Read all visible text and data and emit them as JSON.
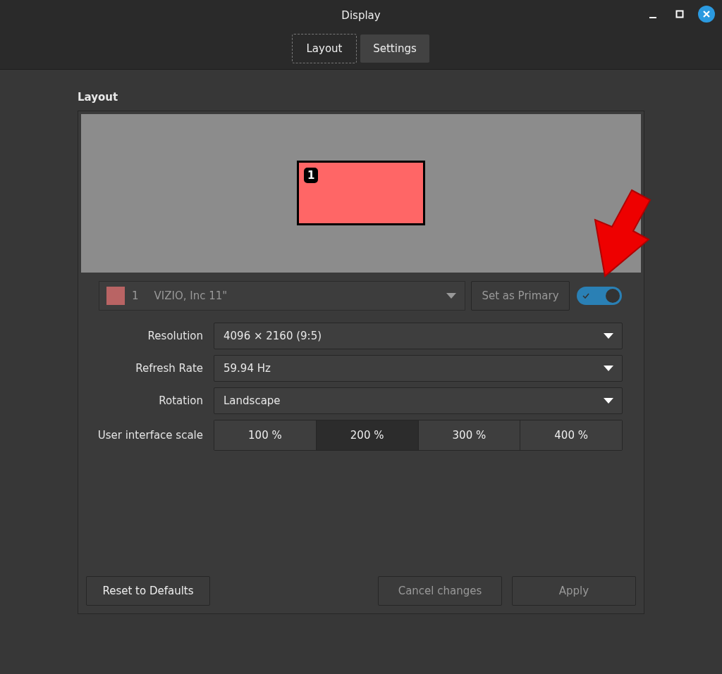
{
  "window": {
    "title": "Display"
  },
  "tabs": [
    {
      "label": "Layout",
      "selected": true
    },
    {
      "label": "Settings",
      "selected": false
    }
  ],
  "section_title": "Layout",
  "monitors": [
    {
      "number": "1",
      "color": "#ff6666"
    }
  ],
  "monitor_select": {
    "number": "1",
    "name": "VIZIO, Inc 11\"",
    "disabled": true
  },
  "set_primary_button": {
    "label": "Set as Primary",
    "disabled": true
  },
  "enabled_switch": {
    "on": true
  },
  "settings": [
    {
      "label": "Resolution",
      "value": "4096 × 2160 (9:5)"
    },
    {
      "label": "Refresh Rate",
      "value": "59.94 Hz"
    },
    {
      "label": "Rotation",
      "value": "Landscape"
    }
  ],
  "scale": {
    "label": "User interface scale",
    "options": [
      {
        "label": "100 %",
        "selected": false
      },
      {
        "label": "200 %",
        "selected": true
      },
      {
        "label": "300 %",
        "selected": false
      },
      {
        "label": "400 %",
        "selected": false
      }
    ]
  },
  "buttons": [
    {
      "label": "Reset to Defaults",
      "disabled": false
    },
    {
      "label": "Cancel changes",
      "disabled": true
    },
    {
      "label": "Apply",
      "disabled": true
    }
  ]
}
